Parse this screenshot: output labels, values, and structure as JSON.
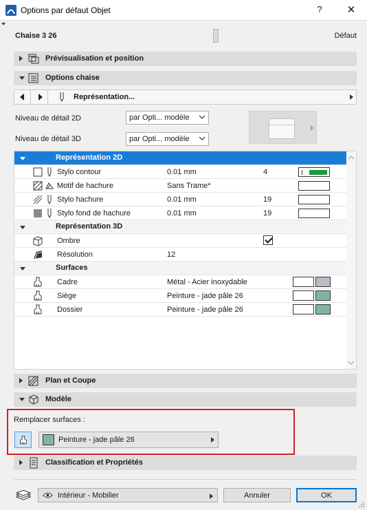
{
  "window": {
    "title": "Options par défaut Objet",
    "help": "?",
    "close": "✕"
  },
  "header": {
    "name": "Chaise 3 26",
    "default": "Défaut"
  },
  "panels": {
    "preview": "Prévisualisation et position",
    "chair_options": "Options chaise",
    "plan_section": "Plan et Coupe",
    "model": "Modèle",
    "classification": "Classification et Propriétés"
  },
  "nav": {
    "page_label": "Représentation..."
  },
  "detail": {
    "level2d_label": "Niveau de détail 2D",
    "level2d_value": "par Opti... modèle",
    "level3d_label": "Niveau de détail 3D",
    "level3d_value": "par Opti... modèle"
  },
  "table": {
    "sections": {
      "rep2d": "Représentation 2D",
      "rep3d": "Représentation 3D",
      "surfaces": "Surfaces"
    },
    "rows": [
      {
        "name": "Stylo contour",
        "value": "0.01 mm",
        "num": "4"
      },
      {
        "name": "Motif de hachure",
        "value": "Sans Trame*",
        "num": ""
      },
      {
        "name": "Stylo hachure",
        "value": "0.01 mm",
        "num": "19"
      },
      {
        "name": "Stylo fond de hachure",
        "value": "0.01 mm",
        "num": "19"
      },
      {
        "name": "Ombre",
        "value": "",
        "num": "",
        "checked": true
      },
      {
        "name": "Résolution",
        "value": "12",
        "num": ""
      },
      {
        "name": "Cadre",
        "value": "Métal - Acier inoxydable",
        "num": "",
        "color": "#b9bcc3"
      },
      {
        "name": "Siège",
        "value": "Peinture - jade pâle 26",
        "num": "",
        "color": "#7fb6a2"
      },
      {
        "name": "Dossier",
        "value": "Peinture - jade pâle 26",
        "num": "",
        "color": "#7fb6a2"
      }
    ]
  },
  "replace": {
    "label": "Remplacer surfaces :",
    "surface": "Peinture - jade pâle 26",
    "color": "#7fb6a2"
  },
  "footer": {
    "layer": "Intérieur - Mobilier",
    "cancel": "Annuler",
    "ok": "OK"
  },
  "colors": {
    "accent": "#1a7ed8",
    "highlight": "#d02020",
    "pen_green": "#1e9a3c"
  }
}
